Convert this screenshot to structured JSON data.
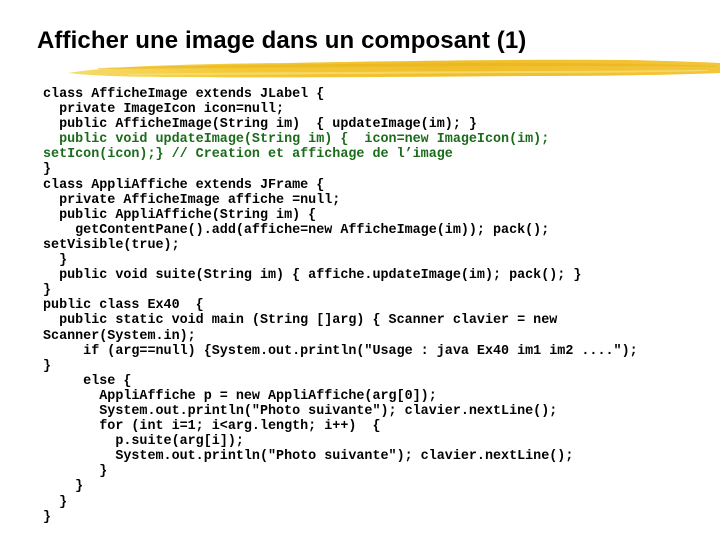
{
  "slide": {
    "title": "Afficher une image dans un composant (1)",
    "accent_colors": {
      "brush_stroke": "#f2c230",
      "highlight_code": "#1a6b1a",
      "code": "#000000"
    },
    "code_lines": [
      {
        "text": "class AfficheImage extends JLabel {",
        "highlight": false
      },
      {
        "text": "  private ImageIcon icon=null;",
        "highlight": false
      },
      {
        "text": "  public AfficheImage(String im)  { updateImage(im); }",
        "highlight": false
      },
      {
        "text": "  public void updateImage(String im) {  icon=new ImageIcon(im);",
        "highlight": true
      },
      {
        "text": "setIcon(icon);} // Creation et affichage de l’image",
        "highlight": true
      },
      {
        "text": "}",
        "highlight": false
      },
      {
        "text": "class AppliAffiche extends JFrame {",
        "highlight": false
      },
      {
        "text": "  private AfficheImage affiche =null;",
        "highlight": false
      },
      {
        "text": "  public AppliAffiche(String im) {",
        "highlight": false
      },
      {
        "text": "    getContentPane().add(affiche=new AfficheImage(im)); pack();",
        "highlight": false
      },
      {
        "text": "setVisible(true);",
        "highlight": false
      },
      {
        "text": "  }",
        "highlight": false
      },
      {
        "text": "  public void suite(String im) { affiche.updateImage(im); pack(); }",
        "highlight": false
      },
      {
        "text": "}",
        "highlight": false
      },
      {
        "text": "public class Ex40  {",
        "highlight": false
      },
      {
        "text": "  public static void main (String []arg) { Scanner clavier = new",
        "highlight": false
      },
      {
        "text": "Scanner(System.in);",
        "highlight": false
      },
      {
        "text": "     if (arg==null) {System.out.println(\"Usage : java Ex40 im1 im2 ....\");",
        "highlight": false
      },
      {
        "text": "}",
        "highlight": false
      },
      {
        "text": "     else {",
        "highlight": false
      },
      {
        "text": "       AppliAffiche p = new AppliAffiche(arg[0]);",
        "highlight": false
      },
      {
        "text": "       System.out.println(\"Photo suivante\"); clavier.nextLine();",
        "highlight": false
      },
      {
        "text": "       for (int i=1; i<arg.length; i++)  {",
        "highlight": false
      },
      {
        "text": "         p.suite(arg[i]);",
        "highlight": false
      },
      {
        "text": "         System.out.println(\"Photo suivante\"); clavier.nextLine();",
        "highlight": false
      },
      {
        "text": "       }",
        "highlight": false
      },
      {
        "text": "    }",
        "highlight": false
      },
      {
        "text": "  }",
        "highlight": false
      },
      {
        "text": "}",
        "highlight": false
      }
    ]
  }
}
